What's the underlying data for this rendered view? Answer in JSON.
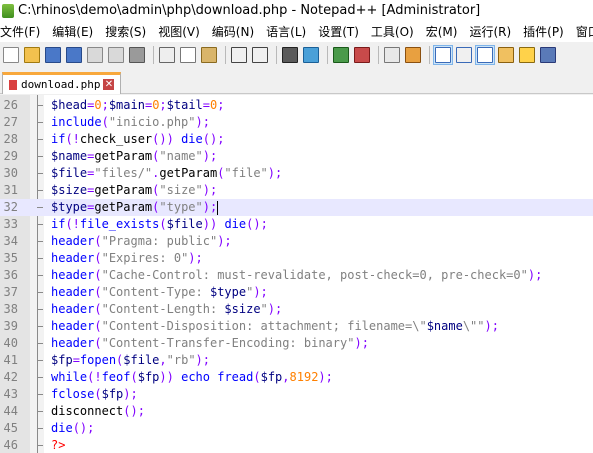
{
  "window": {
    "title": "C:\\rhinos\\demo\\admin\\php\\download.php - Notepad++ [Administrator]"
  },
  "menu": [
    "文件(F)",
    "编辑(E)",
    "搜索(S)",
    "视图(V)",
    "编码(N)",
    "语言(L)",
    "设置(T)",
    "工具(O)",
    "宏(M)",
    "运行(R)",
    "插件(P)",
    "窗口"
  ],
  "toolbar": {
    "icons": [
      "new-file-icon",
      "open-file-icon",
      "save-icon",
      "save-all-icon",
      "close-icon",
      "close-all-icon",
      "print-icon",
      "cut-icon",
      "copy-icon",
      "paste-icon",
      "undo-icon",
      "redo-icon",
      "find-icon",
      "replace-icon",
      "zoom-in-icon",
      "zoom-out-icon",
      "sync-v-icon",
      "sync-h-icon",
      "wrap-icon",
      "all-chars-icon",
      "indent-guide-icon",
      "doc-map-icon",
      "function-list-icon",
      "monitor-icon"
    ]
  },
  "tabs": [
    {
      "label": "download.php",
      "active": true
    }
  ],
  "editor": {
    "current_line": 32,
    "lines": [
      {
        "n": "26",
        "tokens": [
          [
            "v",
            "$head"
          ],
          [
            "o",
            "="
          ],
          [
            "n",
            "0"
          ],
          [
            "o",
            ";"
          ],
          [
            "v",
            "$main"
          ],
          [
            "o",
            "="
          ],
          [
            "n",
            "0"
          ],
          [
            "o",
            ";"
          ],
          [
            "v",
            "$tail"
          ],
          [
            "o",
            "="
          ],
          [
            "n",
            "0"
          ],
          [
            "o",
            ";"
          ]
        ]
      },
      {
        "n": "27",
        "tokens": [
          [
            "k",
            "include"
          ],
          [
            "o",
            "("
          ],
          [
            "s",
            "\"inicio.php\""
          ],
          [
            "o",
            ");"
          ]
        ]
      },
      {
        "n": "28",
        "tokens": [
          [
            "k",
            "if"
          ],
          [
            "o",
            "(!"
          ],
          [
            "f",
            "check_user"
          ],
          [
            "o",
            "())"
          ],
          [
            "f",
            " "
          ],
          [
            "k",
            "die"
          ],
          [
            "o",
            "();"
          ]
        ]
      },
      {
        "n": "29",
        "tokens": [
          [
            "v",
            "$name"
          ],
          [
            "o",
            "="
          ],
          [
            "f",
            "getParam"
          ],
          [
            "o",
            "("
          ],
          [
            "s",
            "\"name\""
          ],
          [
            "o",
            ");"
          ]
        ]
      },
      {
        "n": "30",
        "tokens": [
          [
            "v",
            "$file"
          ],
          [
            "o",
            "="
          ],
          [
            "s",
            "\"files/\""
          ],
          [
            "o",
            "."
          ],
          [
            "f",
            "getParam"
          ],
          [
            "o",
            "("
          ],
          [
            "s",
            "\"file\""
          ],
          [
            "o",
            ");"
          ]
        ]
      },
      {
        "n": "31",
        "tokens": [
          [
            "v",
            "$size"
          ],
          [
            "o",
            "="
          ],
          [
            "f",
            "getParam"
          ],
          [
            "o",
            "("
          ],
          [
            "s",
            "\"size\""
          ],
          [
            "o",
            ");"
          ]
        ]
      },
      {
        "n": "32",
        "tokens": [
          [
            "v",
            "$type"
          ],
          [
            "o",
            "="
          ],
          [
            "f",
            "getParam"
          ],
          [
            "o",
            "("
          ],
          [
            "s",
            "\"type\""
          ],
          [
            "o",
            ");"
          ]
        ]
      },
      {
        "n": "33",
        "tokens": [
          [
            "k",
            "if"
          ],
          [
            "o",
            "(!"
          ],
          [
            "k",
            "file_exists"
          ],
          [
            "o",
            "("
          ],
          [
            "v",
            "$file"
          ],
          [
            "o",
            "))"
          ],
          [
            "f",
            " "
          ],
          [
            "k",
            "die"
          ],
          [
            "o",
            "();"
          ]
        ]
      },
      {
        "n": "34",
        "tokens": [
          [
            "k",
            "header"
          ],
          [
            "o",
            "("
          ],
          [
            "s",
            "\"Pragma: public\""
          ],
          [
            "o",
            ");"
          ]
        ]
      },
      {
        "n": "35",
        "tokens": [
          [
            "k",
            "header"
          ],
          [
            "o",
            "("
          ],
          [
            "s",
            "\"Expires: 0\""
          ],
          [
            "o",
            ");"
          ]
        ]
      },
      {
        "n": "36",
        "tokens": [
          [
            "k",
            "header"
          ],
          [
            "o",
            "("
          ],
          [
            "s",
            "\"Cache-Control: must-revalidate, post-check=0, pre-check=0\""
          ],
          [
            "o",
            ");"
          ]
        ]
      },
      {
        "n": "37",
        "tokens": [
          [
            "k",
            "header"
          ],
          [
            "o",
            "("
          ],
          [
            "s",
            "\"Content-Type: "
          ],
          [
            "v",
            "$type"
          ],
          [
            "s",
            "\""
          ],
          [
            "o",
            ");"
          ]
        ]
      },
      {
        "n": "38",
        "tokens": [
          [
            "k",
            "header"
          ],
          [
            "o",
            "("
          ],
          [
            "s",
            "\"Content-Length: "
          ],
          [
            "v",
            "$size"
          ],
          [
            "s",
            "\""
          ],
          [
            "o",
            ");"
          ]
        ]
      },
      {
        "n": "39",
        "tokens": [
          [
            "k",
            "header"
          ],
          [
            "o",
            "("
          ],
          [
            "s",
            "\"Content-Disposition: attachment; filename=\\\""
          ],
          [
            "v",
            "$name"
          ],
          [
            "s",
            "\\\"\""
          ],
          [
            "o",
            ");"
          ]
        ]
      },
      {
        "n": "40",
        "tokens": [
          [
            "k",
            "header"
          ],
          [
            "o",
            "("
          ],
          [
            "s",
            "\"Content-Transfer-Encoding: binary\""
          ],
          [
            "o",
            ");"
          ]
        ]
      },
      {
        "n": "41",
        "tokens": [
          [
            "v",
            "$fp"
          ],
          [
            "o",
            "="
          ],
          [
            "k",
            "fopen"
          ],
          [
            "o",
            "("
          ],
          [
            "v",
            "$file"
          ],
          [
            "o",
            ","
          ],
          [
            "s",
            "\"rb\""
          ],
          [
            "o",
            ");"
          ]
        ]
      },
      {
        "n": "42",
        "tokens": [
          [
            "k",
            "while"
          ],
          [
            "o",
            "(!"
          ],
          [
            "k",
            "feof"
          ],
          [
            "o",
            "("
          ],
          [
            "v",
            "$fp"
          ],
          [
            "o",
            "))"
          ],
          [
            "f",
            " "
          ],
          [
            "k",
            "echo"
          ],
          [
            "f",
            " "
          ],
          [
            "k",
            "fread"
          ],
          [
            "o",
            "("
          ],
          [
            "v",
            "$fp"
          ],
          [
            "o",
            ","
          ],
          [
            "n",
            "8192"
          ],
          [
            "o",
            ");"
          ]
        ]
      },
      {
        "n": "43",
        "tokens": [
          [
            "k",
            "fclose"
          ],
          [
            "o",
            "("
          ],
          [
            "v",
            "$fp"
          ],
          [
            "o",
            ");"
          ]
        ]
      },
      {
        "n": "44",
        "tokens": [
          [
            "f",
            "disconnect"
          ],
          [
            "o",
            "();"
          ]
        ]
      },
      {
        "n": "45",
        "tokens": [
          [
            "k",
            "die"
          ],
          [
            "o",
            "();"
          ]
        ]
      },
      {
        "n": "46",
        "tokens": [
          [
            "t",
            "?>"
          ]
        ]
      }
    ]
  }
}
